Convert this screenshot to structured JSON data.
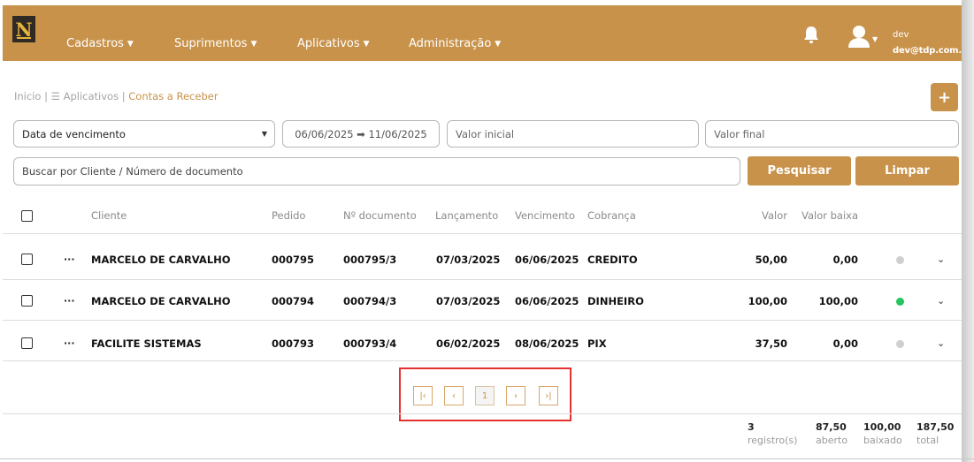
{
  "navbar": {
    "logo_text": "N",
    "menus": [
      {
        "label": "Cadastros"
      },
      {
        "label": "Suprimentos"
      },
      {
        "label": "Aplicativos"
      },
      {
        "label": "Administração"
      }
    ],
    "user": {
      "name": "dev",
      "email": "dev@tdp.com.br"
    },
    "brand_color": "#c8924a"
  },
  "breadcrumb": {
    "home": "Inicio",
    "sep1": "|",
    "apps_icon": "list-icon",
    "apps": "Aplicativos",
    "sep2": "|",
    "current": "Contas a Receber"
  },
  "add_button": {
    "label": "+"
  },
  "filters": {
    "date_type": "Data de vencimento",
    "date_range": "06/06/2025 ➡ 11/06/2025",
    "valor_inicial_placeholder": "Valor inicial",
    "valor_final_placeholder": "Valor final",
    "search_placeholder": "Buscar por Cliente / Número de documento",
    "search_button": "Pesquisar",
    "clear_button": "Limpar"
  },
  "table": {
    "headers": {
      "cliente": "Cliente",
      "pedido": "Pedido",
      "documento": "Nº documento",
      "lancamento": "Lançamento",
      "vencimento": "Vencimento",
      "cobranca": "Cobrança",
      "valor": "Valor",
      "valor_baixa": "Valor baixa"
    },
    "rows": [
      {
        "menu": "···",
        "cliente": "MARCELO DE CARVALHO",
        "pedido": "000795",
        "documento": "000795/3",
        "lancamento": "07/03/2025",
        "vencimento": "06/06/2025",
        "cobranca": "CREDITO",
        "valor": "50,00",
        "valor_baixa": "0,00",
        "status_color": "#cfcfcf"
      },
      {
        "menu": "···",
        "cliente": "MARCELO DE CARVALHO",
        "pedido": "000794",
        "documento": "000794/3",
        "lancamento": "07/03/2025",
        "vencimento": "06/06/2025",
        "cobranca": "DINHEIRO",
        "valor": "100,00",
        "valor_baixa": "100,00",
        "status_color": "#22c55e"
      },
      {
        "menu": "···",
        "cliente": "FACILITE SISTEMAS",
        "pedido": "000793",
        "documento": "000793/4",
        "lancamento": "06/02/2025",
        "vencimento": "08/06/2025",
        "cobranca": "PIX",
        "valor": "37,50",
        "valor_baixa": "0,00",
        "status_color": "#cfcfcf"
      }
    ]
  },
  "pagination": {
    "first": "|‹",
    "prev": "‹",
    "page": "1",
    "next": "›",
    "last": "›|"
  },
  "totals": {
    "registros": {
      "value": "3",
      "label": "registro(s)"
    },
    "aberto": {
      "value": "87,50",
      "label": "aberto"
    },
    "baixado": {
      "value": "100,00",
      "label": "baixado"
    },
    "total": {
      "value": "187,50",
      "label": "total"
    }
  }
}
